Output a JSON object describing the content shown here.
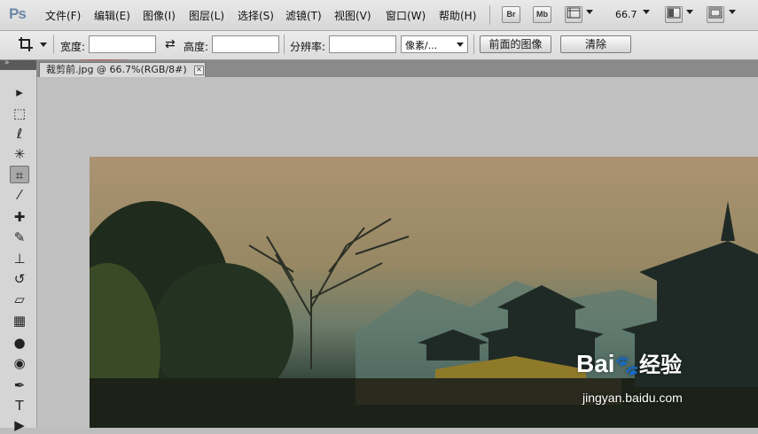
{
  "app": {
    "logo": "Ps"
  },
  "menu": [
    "文件(F)",
    "编辑(E)",
    "图像(I)",
    "图层(L)",
    "选择(S)",
    "滤镜(T)",
    "视图(V)",
    "窗口(W)",
    "帮助(H)"
  ],
  "toolbar": {
    "bridge_label": "Br",
    "mini_bridge_label": "Mb",
    "zoom_value": "66.7"
  },
  "options": {
    "width_label": "宽度:",
    "width_value": "",
    "height_label": "高度:",
    "height_value": "",
    "resolution_label": "分辨率:",
    "resolution_value": "",
    "unit_selected": "像素/...",
    "front_image_label": "前面的图像",
    "clear_label": "清除"
  },
  "document": {
    "tab_title": "裁剪前.jpg @ 66.7%(RGB/8#)",
    "close_glyph": "✕"
  },
  "tools": [
    {
      "name": "move-tool-icon",
      "glyph": "▸"
    },
    {
      "name": "marquee-tool-icon",
      "glyph": "⬚"
    },
    {
      "name": "lasso-tool-icon",
      "glyph": "ℓ"
    },
    {
      "name": "magic-wand-tool-icon",
      "glyph": "✳"
    },
    {
      "name": "crop-tool-icon",
      "glyph": "⌗",
      "active": true
    },
    {
      "name": "eyedropper-tool-icon",
      "glyph": "⁄"
    },
    {
      "name": "healing-brush-tool-icon",
      "glyph": "✚"
    },
    {
      "name": "brush-tool-icon",
      "glyph": "✎"
    },
    {
      "name": "clone-stamp-tool-icon",
      "glyph": "⊥"
    },
    {
      "name": "history-brush-tool-icon",
      "glyph": "↺"
    },
    {
      "name": "eraser-tool-icon",
      "glyph": "▱"
    },
    {
      "name": "gradient-tool-icon",
      "glyph": "▦"
    },
    {
      "name": "blur-tool-icon",
      "glyph": "●"
    },
    {
      "name": "dodge-tool-icon",
      "glyph": "◉"
    },
    {
      "name": "pen-tool-icon",
      "glyph": "✒"
    },
    {
      "name": "type-tool-icon",
      "glyph": "T"
    },
    {
      "name": "path-selection-tool-icon",
      "glyph": "▶"
    }
  ],
  "watermark": {
    "brand": "Bai",
    "brand_cn": "经验",
    "url": "jingyan.baidu.com"
  },
  "colors": {
    "annotation_red": "#e0242a",
    "menubar_bg": "#dedede",
    "canvas_bg": "#c0c0c0"
  }
}
